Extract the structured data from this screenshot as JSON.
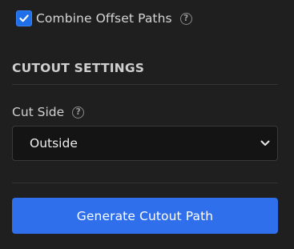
{
  "combine": {
    "label": "Combine Offset Paths",
    "checked": true,
    "help_glyph": "?"
  },
  "cutout_settings": {
    "title": "CUTOUT SETTINGS",
    "cut_side": {
      "label": "Cut Side",
      "help_glyph": "?",
      "selected": "Outside"
    }
  },
  "actions": {
    "generate_label": "Generate Cutout Path"
  },
  "colors": {
    "accent": "#2f6fec",
    "background": "#1f1f1f",
    "select_background": "#141414"
  },
  "icons": {
    "checkbox": "checkmark-icon",
    "help": "question-circle-icon",
    "select": "chevron-down-icon"
  }
}
